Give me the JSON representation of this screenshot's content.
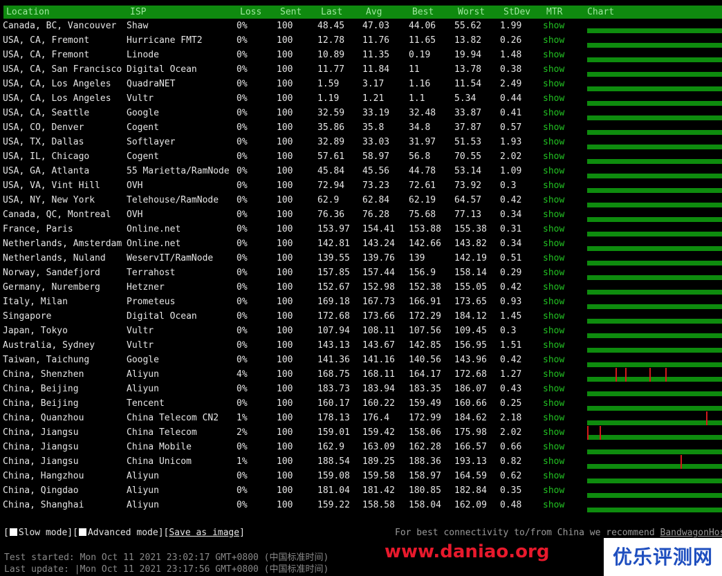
{
  "header": {
    "location": "Location",
    "isp": "ISP",
    "loss": "Loss",
    "sent": "Sent",
    "last": "Last",
    "avg": "Avg",
    "best": "Best",
    "worst": "Worst",
    "stdev": "StDev",
    "mtr": "MTR",
    "chart": "Chart"
  },
  "mtr_link_text": "show",
  "rows": [
    {
      "location": "Canada, BC, Vancouver",
      "isp": "Shaw",
      "loss": "0%",
      "sent": "100",
      "last": "48.45",
      "avg": "47.03",
      "best": "44.06",
      "worst": "55.62",
      "stdev": "1.99",
      "spikes": []
    },
    {
      "location": "USA, CA, Fremont",
      "isp": "Hurricane FMT2",
      "loss": "0%",
      "sent": "100",
      "last": "12.78",
      "avg": "11.76",
      "best": "11.65",
      "worst": "13.82",
      "stdev": "0.26",
      "spikes": []
    },
    {
      "location": "USA, CA, Fremont",
      "isp": "Linode",
      "loss": "0%",
      "sent": "100",
      "last": "10.89",
      "avg": "11.35",
      "best": "0.19",
      "worst": "19.94",
      "stdev": "1.48",
      "spikes": []
    },
    {
      "location": "USA, CA, San Francisco",
      "isp": "Digital Ocean",
      "loss": "0%",
      "sent": "100",
      "last": "11.77",
      "avg": "11.84",
      "best": "11",
      "worst": "13.78",
      "stdev": "0.38",
      "spikes": []
    },
    {
      "location": "USA, CA, Los Angeles",
      "isp": "QuadraNET",
      "loss": "0%",
      "sent": "100",
      "last": "1.59",
      "avg": "3.17",
      "best": "1.16",
      "worst": "11.54",
      "stdev": "2.49",
      "spikes": []
    },
    {
      "location": "USA, CA, Los Angeles",
      "isp": "Vultr",
      "loss": "0%",
      "sent": "100",
      "last": "1.19",
      "avg": "1.21",
      "best": "1.1",
      "worst": "5.34",
      "stdev": "0.44",
      "spikes": []
    },
    {
      "location": "USA, CA, Seattle",
      "isp": "Google",
      "loss": "0%",
      "sent": "100",
      "last": "32.59",
      "avg": "33.19",
      "best": "32.48",
      "worst": "33.87",
      "stdev": "0.41",
      "spikes": []
    },
    {
      "location": "USA, CO, Denver",
      "isp": "Cogent",
      "loss": "0%",
      "sent": "100",
      "last": "35.86",
      "avg": "35.8",
      "best": "34.8",
      "worst": "37.87",
      "stdev": "0.57",
      "spikes": []
    },
    {
      "location": "USA, TX, Dallas",
      "isp": "Softlayer",
      "loss": "0%",
      "sent": "100",
      "last": "32.89",
      "avg": "33.03",
      "best": "31.97",
      "worst": "51.53",
      "stdev": "1.93",
      "spikes": []
    },
    {
      "location": "USA, IL, Chicago",
      "isp": "Cogent",
      "loss": "0%",
      "sent": "100",
      "last": "57.61",
      "avg": "58.97",
      "best": "56.8",
      "worst": "70.55",
      "stdev": "2.02",
      "spikes": []
    },
    {
      "location": "USA, GA, Atlanta",
      "isp": "55 Marietta/RamNode",
      "loss": "0%",
      "sent": "100",
      "last": "45.84",
      "avg": "45.56",
      "best": "44.78",
      "worst": "53.14",
      "stdev": "1.09",
      "spikes": []
    },
    {
      "location": "USA, VA, Vint Hill",
      "isp": "OVH",
      "loss": "0%",
      "sent": "100",
      "last": "72.94",
      "avg": "73.23",
      "best": "72.61",
      "worst": "73.92",
      "stdev": "0.3",
      "spikes": []
    },
    {
      "location": "USA, NY, New York",
      "isp": "Telehouse/RamNode",
      "loss": "0%",
      "sent": "100",
      "last": "62.9",
      "avg": "62.84",
      "best": "62.19",
      "worst": "64.57",
      "stdev": "0.42",
      "spikes": []
    },
    {
      "location": "Canada, QC, Montreal",
      "isp": "OVH",
      "loss": "0%",
      "sent": "100",
      "last": "76.36",
      "avg": "76.28",
      "best": "75.68",
      "worst": "77.13",
      "stdev": "0.34",
      "spikes": []
    },
    {
      "location": "France, Paris",
      "isp": "Online.net",
      "loss": "0%",
      "sent": "100",
      "last": "153.97",
      "avg": "154.41",
      "best": "153.88",
      "worst": "155.38",
      "stdev": "0.31",
      "spikes": []
    },
    {
      "location": "Netherlands, Amsterdam",
      "isp": "Online.net",
      "loss": "0%",
      "sent": "100",
      "last": "142.81",
      "avg": "143.24",
      "best": "142.66",
      "worst": "143.82",
      "stdev": "0.34",
      "spikes": []
    },
    {
      "location": "Netherlands, Nuland",
      "isp": "WeservIT/RamNode",
      "loss": "0%",
      "sent": "100",
      "last": "139.55",
      "avg": "139.76",
      "best": "139",
      "worst": "142.19",
      "stdev": "0.51",
      "spikes": []
    },
    {
      "location": "Norway, Sandefjord",
      "isp": "Terrahost",
      "loss": "0%",
      "sent": "100",
      "last": "157.85",
      "avg": "157.44",
      "best": "156.9",
      "worst": "158.14",
      "stdev": "0.29",
      "spikes": []
    },
    {
      "location": "Germany, Nuremberg",
      "isp": "Hetzner",
      "loss": "0%",
      "sent": "100",
      "last": "152.67",
      "avg": "152.98",
      "best": "152.38",
      "worst": "155.05",
      "stdev": "0.42",
      "spikes": []
    },
    {
      "location": "Italy, Milan",
      "isp": "Prometeus",
      "loss": "0%",
      "sent": "100",
      "last": "169.18",
      "avg": "167.73",
      "best": "166.91",
      "worst": "173.65",
      "stdev": "0.93",
      "spikes": []
    },
    {
      "location": "Singapore",
      "isp": "Digital Ocean",
      "loss": "0%",
      "sent": "100",
      "last": "172.68",
      "avg": "173.66",
      "best": "172.29",
      "worst": "184.12",
      "stdev": "1.45",
      "spikes": []
    },
    {
      "location": "Japan, Tokyo",
      "isp": "Vultr",
      "loss": "0%",
      "sent": "100",
      "last": "107.94",
      "avg": "108.11",
      "best": "107.56",
      "worst": "109.45",
      "stdev": "0.3",
      "spikes": []
    },
    {
      "location": "Australia, Sydney",
      "isp": "Vultr",
      "loss": "0%",
      "sent": "100",
      "last": "143.13",
      "avg": "143.67",
      "best": "142.85",
      "worst": "156.95",
      "stdev": "1.51",
      "spikes": []
    },
    {
      "location": "Taiwan, Taichung",
      "isp": "Google",
      "loss": "0%",
      "sent": "100",
      "last": "141.36",
      "avg": "141.16",
      "best": "140.56",
      "worst": "143.96",
      "stdev": "0.42",
      "spikes": []
    },
    {
      "location": "China, Shenzhen",
      "isp": "Aliyun",
      "loss": "4%",
      "sent": "100",
      "last": "168.75",
      "avg": "168.11",
      "best": "164.17",
      "worst": "172.68",
      "stdev": "1.27",
      "spikes": [
        0.21,
        0.28,
        0.46,
        0.58
      ]
    },
    {
      "location": "China, Beijing",
      "isp": "Aliyun",
      "loss": "0%",
      "sent": "100",
      "last": "183.73",
      "avg": "183.94",
      "best": "183.35",
      "worst": "186.07",
      "stdev": "0.43",
      "spikes": []
    },
    {
      "location": "China, Beijing",
      "isp": "Tencent",
      "loss": "0%",
      "sent": "100",
      "last": "160.17",
      "avg": "160.22",
      "best": "159.49",
      "worst": "160.66",
      "stdev": "0.25",
      "spikes": []
    },
    {
      "location": "China, Quanzhou",
      "isp": "China Telecom CN2",
      "loss": "1%",
      "sent": "100",
      "last": "178.13",
      "avg": "176.4",
      "best": "172.99",
      "worst": "184.62",
      "stdev": "2.18",
      "spikes": [
        0.88
      ]
    },
    {
      "location": "China, Jiangsu",
      "isp": "China Telecom",
      "loss": "2%",
      "sent": "100",
      "last": "159.01",
      "avg": "159.42",
      "best": "158.06",
      "worst": "175.98",
      "stdev": "2.02",
      "spikes": [
        0.0,
        0.09
      ]
    },
    {
      "location": "China, Jiangsu",
      "isp": "China Mobile",
      "loss": "0%",
      "sent": "100",
      "last": "162.9",
      "avg": "163.09",
      "best": "162.28",
      "worst": "166.57",
      "stdev": "0.66",
      "spikes": []
    },
    {
      "location": "China, Jiangsu",
      "isp": "China Unicom",
      "loss": "1%",
      "sent": "100",
      "last": "188.54",
      "avg": "189.25",
      "best": "188.36",
      "worst": "193.13",
      "stdev": "0.82",
      "spikes": [
        0.69
      ]
    },
    {
      "location": "China, Hangzhou",
      "isp": "Aliyun",
      "loss": "0%",
      "sent": "100",
      "last": "159.08",
      "avg": "159.58",
      "best": "158.97",
      "worst": "164.59",
      "stdev": "0.62",
      "spikes": []
    },
    {
      "location": "China, Qingdao",
      "isp": "Aliyun",
      "loss": "0%",
      "sent": "100",
      "last": "181.04",
      "avg": "181.42",
      "best": "180.85",
      "worst": "182.84",
      "stdev": "0.35",
      "spikes": []
    },
    {
      "location": "China, Shanghai",
      "isp": "Aliyun",
      "loss": "0%",
      "sent": "100",
      "last": "159.22",
      "avg": "158.58",
      "best": "158.04",
      "worst": "162.09",
      "stdev": "0.48",
      "spikes": []
    }
  ],
  "footer": {
    "open_bracket": "[",
    "slow_mode": "Slow mode",
    "mid_bracket": "][",
    "advanced_mode": "Advanced mode",
    "mid_bracket2": "][",
    "save_as_image": "Save as image",
    "close_bracket": "]",
    "recommend_text": "For best connectivity to/from China we recommend ",
    "recommend_link": "BandwagonHost",
    "test_started": "Test started: Mon Oct 11 2021 23:02:17 GMT+0800 (中国标准时间)",
    "last_update": "Last update: |Mon Oct 11 2021 23:17:56 GMT+0800 (中国标准时间)"
  },
  "watermarks": {
    "site": "www.daniao.org",
    "badge": "优乐评测网"
  },
  "colors": {
    "header_bg": "#0f8a0f",
    "chart_bar": "#0e8c0e",
    "loss_spike": "#d41a1a",
    "mtr_link": "#22c322"
  }
}
